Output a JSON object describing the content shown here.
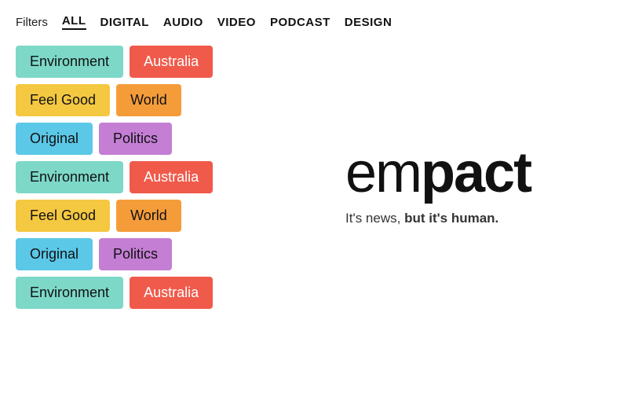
{
  "header": {
    "filters_label": "Filters",
    "filter_items": [
      {
        "id": "all",
        "label": "ALL",
        "active": true
      },
      {
        "id": "digital",
        "label": "DIGITAL",
        "active": false
      },
      {
        "id": "audio",
        "label": "AUDIO",
        "active": false
      },
      {
        "id": "video",
        "label": "VIDEO",
        "active": false
      },
      {
        "id": "podcast",
        "label": "PODCAST",
        "active": false
      },
      {
        "id": "design",
        "label": "DESIGN",
        "active": false
      }
    ]
  },
  "tags": {
    "rows": [
      [
        {
          "label": "Environment",
          "type": "environment"
        },
        {
          "label": "Australia",
          "type": "australia"
        }
      ],
      [
        {
          "label": "Feel Good",
          "type": "feelgood"
        },
        {
          "label": "World",
          "type": "world"
        }
      ],
      [
        {
          "label": "Original",
          "type": "original"
        },
        {
          "label": "Politics",
          "type": "politics"
        }
      ],
      [
        {
          "label": "Environment",
          "type": "environment"
        },
        {
          "label": "Australia",
          "type": "australia"
        }
      ],
      [
        {
          "label": "Feel Good",
          "type": "feelgood"
        },
        {
          "label": "World",
          "type": "world"
        }
      ],
      [
        {
          "label": "Original",
          "type": "original"
        },
        {
          "label": "Politics",
          "type": "politics"
        }
      ],
      [
        {
          "label": "Environment",
          "type": "environment"
        },
        {
          "label": "Australia",
          "type": "australia"
        }
      ]
    ]
  },
  "brand": {
    "logo_em": "em",
    "logo_pact": "pact",
    "tagline_plain": "It's news, ",
    "tagline_bold": "but it's human.",
    "tagline_full": "It's news, but it's human."
  }
}
